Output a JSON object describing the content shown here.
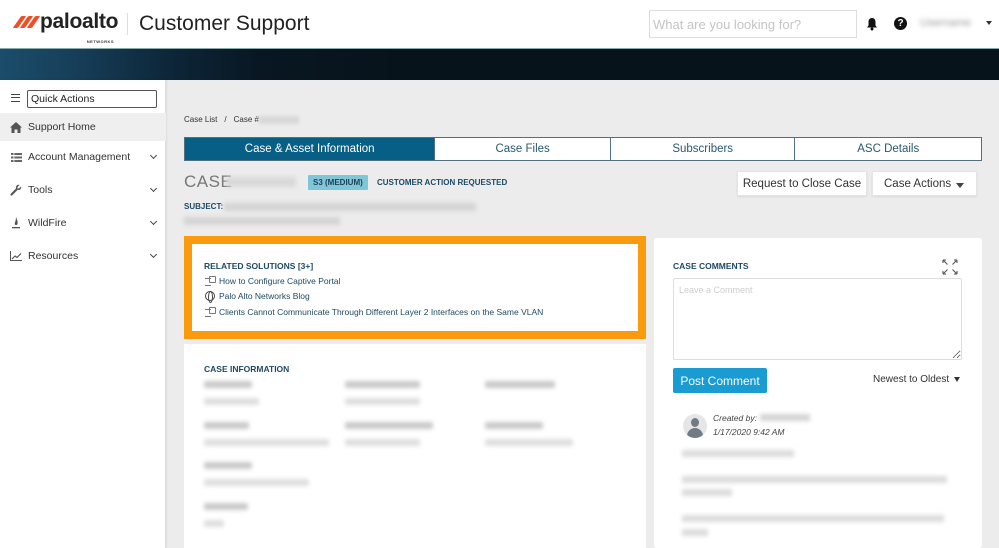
{
  "header": {
    "brand": "paloalto",
    "brand_sub": "NETWORKS",
    "app_title": "Customer Support",
    "search_placeholder": "What are you looking for?",
    "icons": [
      "bell-icon",
      "help-icon"
    ],
    "user_name": "Username"
  },
  "sidebar": {
    "quick_actions": "Quick Actions",
    "items": [
      {
        "label": "Support Home",
        "icon": "home-icon",
        "expandable": false,
        "active": true
      },
      {
        "label": "Account Management",
        "icon": "list-icon",
        "expandable": true
      },
      {
        "label": "Tools",
        "icon": "wrench-icon",
        "expandable": true
      },
      {
        "label": "WildFire",
        "icon": "fire-icon",
        "expandable": true
      },
      {
        "label": "Resources",
        "icon": "chart-icon",
        "expandable": true
      }
    ]
  },
  "breadcrumb": {
    "items": [
      "Case List",
      "Case #"
    ],
    "separator": "/"
  },
  "tabs": [
    {
      "label": "Case & Asset Information",
      "active": true
    },
    {
      "label": "Case Files",
      "active": false
    },
    {
      "label": "Subscribers",
      "active": false
    },
    {
      "label": "ASC Details",
      "active": false
    }
  ],
  "case": {
    "label": "CASE",
    "severity": "S3 (MEDIUM)",
    "status": "CUSTOMER ACTION REQUESTED",
    "subject_label": "SUBJECT:"
  },
  "actions": {
    "request_close": "Request to Close Case",
    "case_actions": "Case Actions"
  },
  "related_solutions": {
    "title": "RELATED SOLUTIONS [3+]",
    "items": [
      {
        "label": "How to Configure Captive Portal",
        "icon": "document-icon"
      },
      {
        "label": "Palo Alto Networks Blog",
        "icon": "globe-icon"
      },
      {
        "label": "Clients Cannot Communicate Through Different Layer 2 Interfaces on the Same VLAN",
        "icon": "document-icon"
      }
    ]
  },
  "case_information": {
    "title": "CASE INFORMATION"
  },
  "comments": {
    "title": "CASE COMMENTS",
    "placeholder": "Leave a Comment",
    "post_button": "Post Comment",
    "sort": "Newest to Oldest",
    "entries": [
      {
        "created_by_label": "Created by:",
        "date": "1/17/2020 9:42 AM"
      }
    ]
  },
  "colors": {
    "accent_orange": "#fa9a0e",
    "tab_active": "#075f85",
    "post_button": "#1a9bd2",
    "severity_badge": "#7fc7d8",
    "brand_red": "#f04e23"
  }
}
